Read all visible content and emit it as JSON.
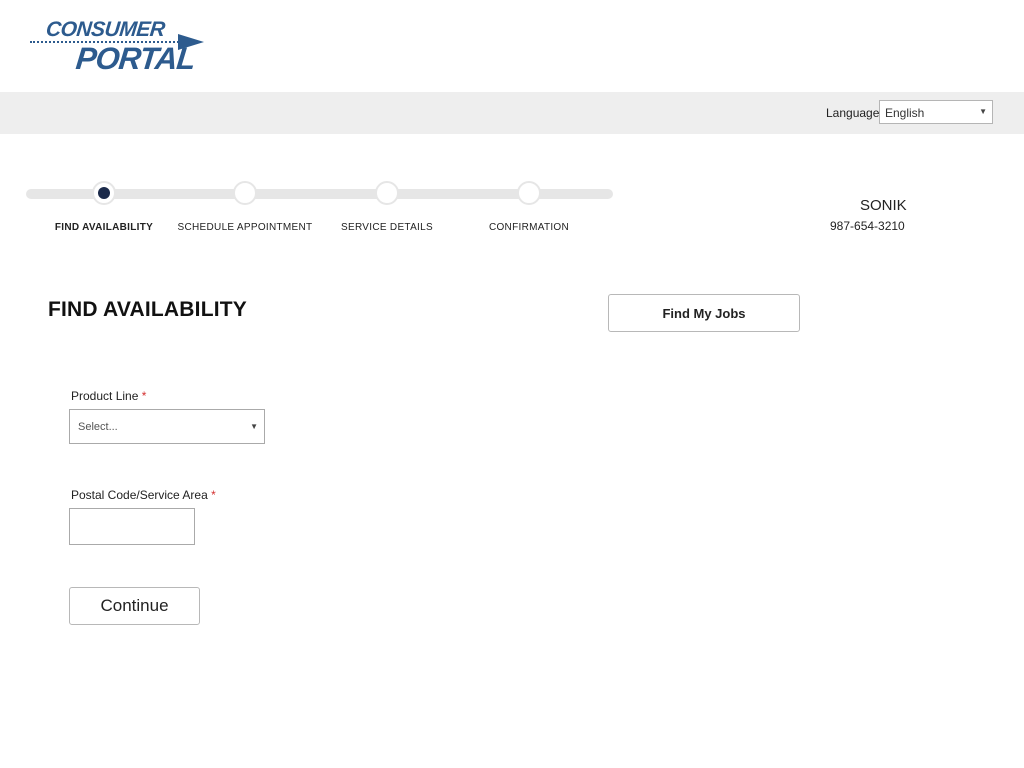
{
  "header": {
    "logo_line1": "CONSUMER",
    "logo_line2": "PORTAL"
  },
  "language_bar": {
    "label": "Language",
    "selected": "English"
  },
  "steps": [
    {
      "label": "FIND AVAILABILITY",
      "active": true
    },
    {
      "label": "SCHEDULE APPOINTMENT",
      "active": false
    },
    {
      "label": "SERVICE DETAILS",
      "active": false
    },
    {
      "label": "CONFIRMATION",
      "active": false
    }
  ],
  "contact": {
    "name": "SONIK",
    "phone": "987-654-3210"
  },
  "main": {
    "title": "FIND AVAILABILITY",
    "find_jobs_label": "Find My Jobs",
    "product_line": {
      "label": "Product Line",
      "required_mark": "*",
      "selected": "Select..."
    },
    "postal_code": {
      "label": "Postal Code/Service Area",
      "required_mark": "*",
      "value": ""
    },
    "continue_label": "Continue"
  },
  "colors": {
    "brand": "#2d5b8e",
    "active_step": "#1b2a4a",
    "required": "#d32f2f",
    "bar_bg": "#eeeeee"
  }
}
